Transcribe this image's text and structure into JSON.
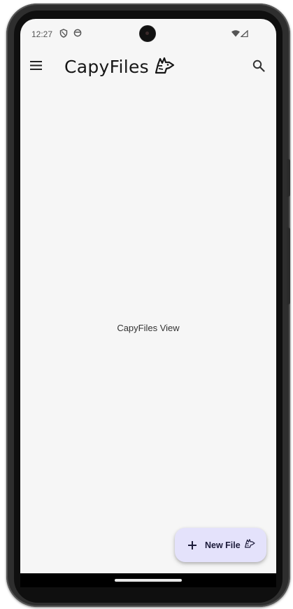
{
  "status_bar": {
    "time": "12:27",
    "icons": [
      "shield-icon",
      "circle-status-icon",
      "wifi-icon",
      "signal-icon"
    ]
  },
  "app_bar": {
    "title": "CapyFiles",
    "brand_icon": "capybara-logo-icon",
    "menu_icon": "menu-icon",
    "search_icon": "search-icon"
  },
  "main": {
    "placeholder_text": "CapyFiles View"
  },
  "fab": {
    "label": "New File",
    "icon": "plus-icon",
    "trailing_icon": "capybara-logo-icon",
    "background_color": "#e4e2fb"
  },
  "colors": {
    "screen_background": "#f6f6f6",
    "title_text": "#161616"
  }
}
